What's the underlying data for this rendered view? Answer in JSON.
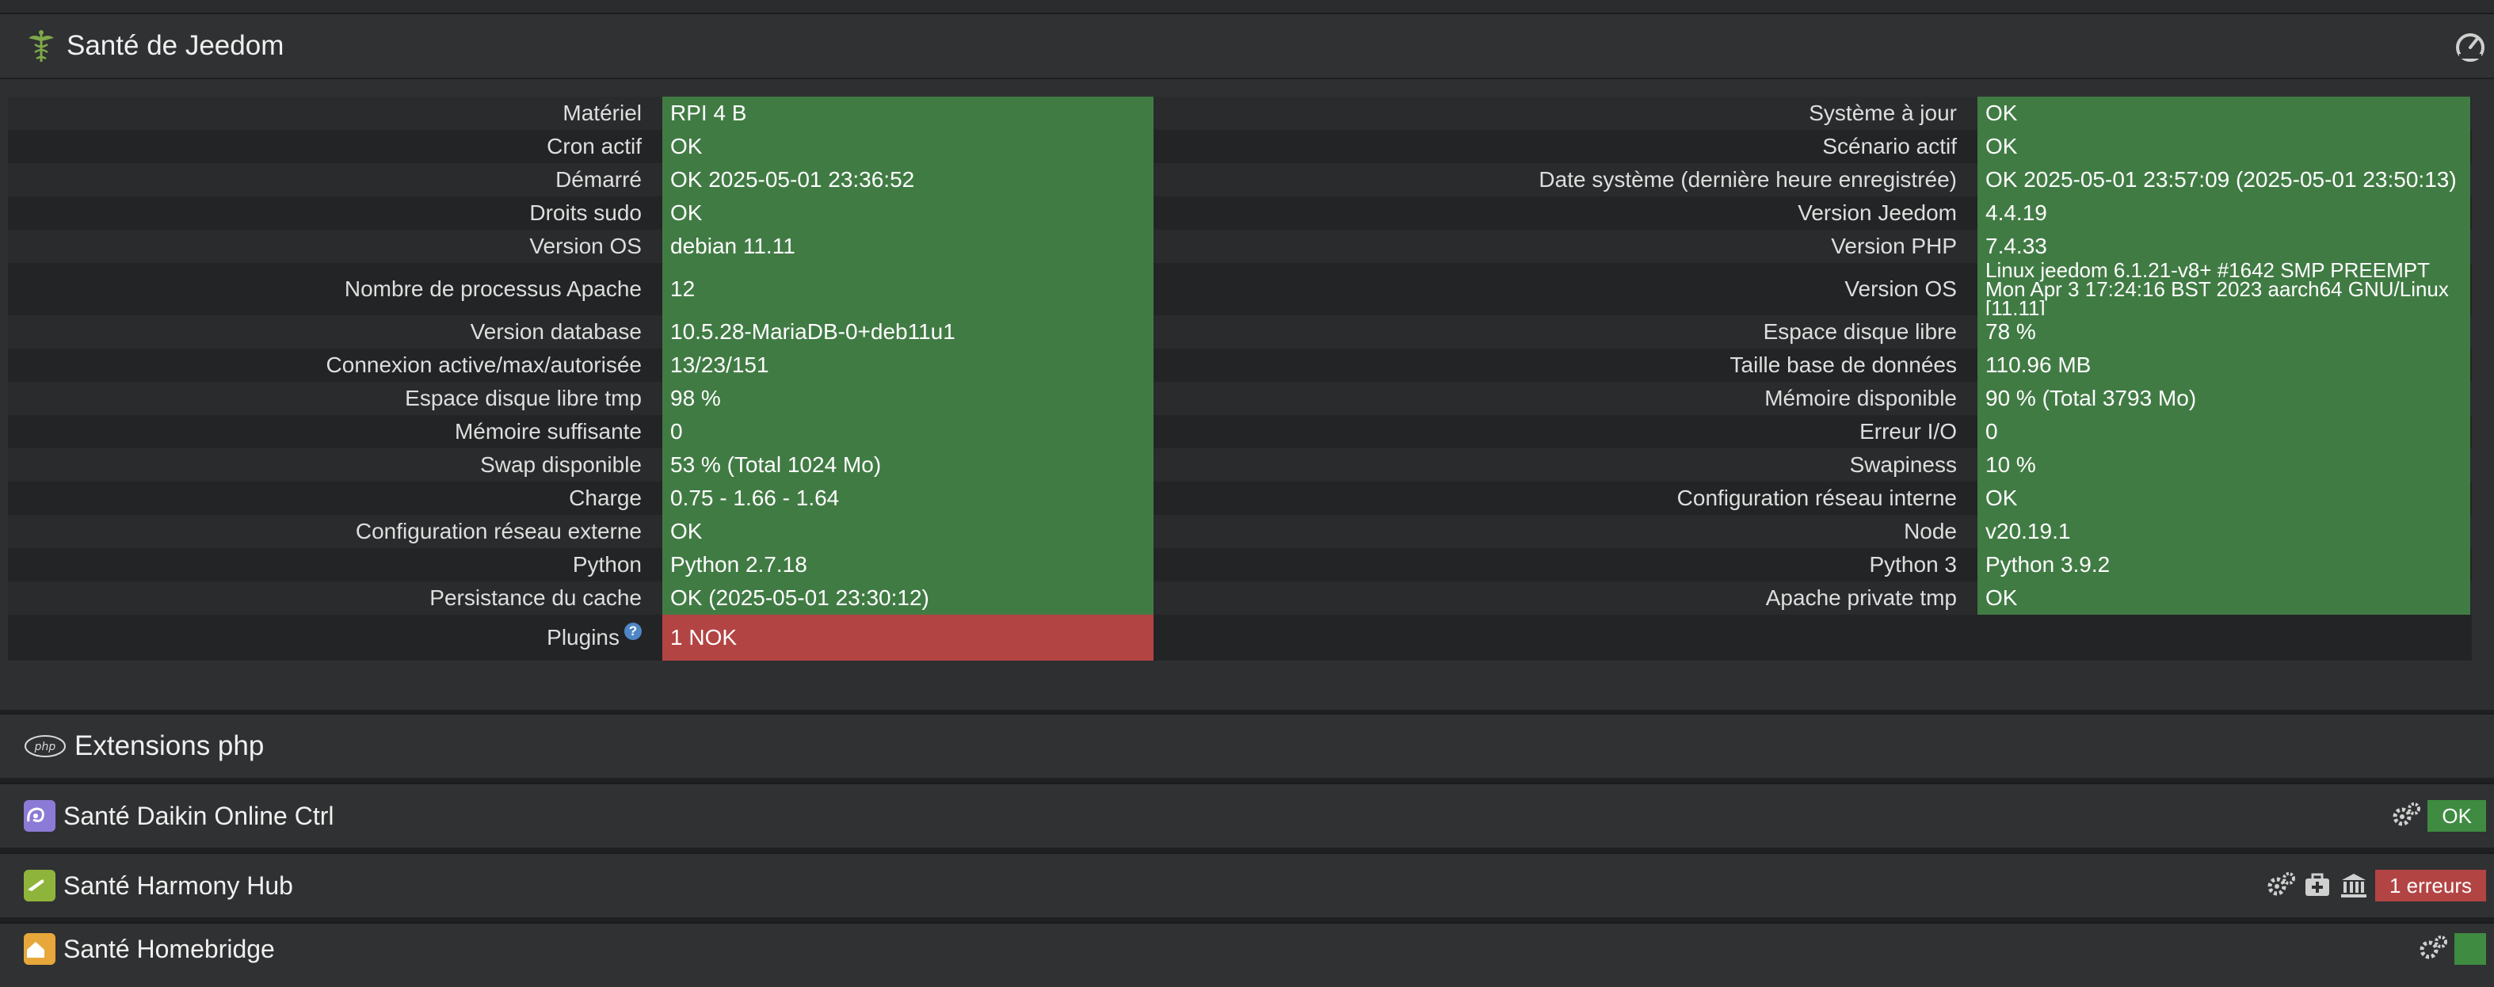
{
  "health": {
    "title": "Santé de Jeedom",
    "left_rows": [
      {
        "label": "Matériel",
        "value": "RPI 4 B"
      },
      {
        "label": "Cron actif",
        "value": "OK"
      },
      {
        "label": "Démarré",
        "value": "OK 2025-05-01 23:36:52"
      },
      {
        "label": "Droits sudo",
        "value": "OK"
      },
      {
        "label": "Version OS",
        "value": "debian 11.11"
      },
      {
        "label": "Nombre de processus Apache",
        "value": "12"
      },
      {
        "label": "Version database",
        "value": "10.5.28-MariaDB-0+deb11u1"
      },
      {
        "label": "Connexion active/max/autorisée",
        "value": "13/23/151"
      },
      {
        "label": "Espace disque libre tmp",
        "value": "98 %"
      },
      {
        "label": "Mémoire suffisante",
        "value": "0"
      },
      {
        "label": "Swap disponible",
        "value": "53 % (Total 1024 Mo)"
      },
      {
        "label": "Charge",
        "value": "0.75 - 1.66 - 1.64"
      },
      {
        "label": "Configuration réseau externe",
        "value": "OK"
      },
      {
        "label": "Python",
        "value": "Python 2.7.18"
      },
      {
        "label": "Persistance du cache",
        "value": "OK (2025-05-01 23:30:12)"
      },
      {
        "label": "Plugins",
        "value": "1 NOK",
        "status": "nok"
      }
    ],
    "right_rows": [
      {
        "label": "Système à jour",
        "value": "OK"
      },
      {
        "label": "Scénario actif",
        "value": "OK"
      },
      {
        "label": "Date système (dernière heure enregistrée)",
        "value": "OK 2025-05-01 23:57:09 (2025-05-01 23:50:13)"
      },
      {
        "label": "Version Jeedom",
        "value": "4.4.19"
      },
      {
        "label": "Version PHP",
        "value": "7.4.33"
      },
      {
        "label": "Version OS",
        "value": "Linux jeedom 6.1.21-v8+ #1642 SMP PREEMPT Mon Apr 3 17:24:16 BST 2023 aarch64 GNU/Linux [11.11]"
      },
      {
        "label": "Espace disque libre",
        "value": "78 %"
      },
      {
        "label": "Taille base de données",
        "value": "110.96 MB"
      },
      {
        "label": "Mémoire disponible",
        "value": "90 % (Total 3793 Mo)"
      },
      {
        "label": "Erreur I/O",
        "value": "0"
      },
      {
        "label": "Swapiness",
        "value": "10 %"
      },
      {
        "label": "Configuration réseau interne",
        "value": "OK"
      },
      {
        "label": "Node",
        "value": "v20.19.1"
      },
      {
        "label": "Python 3",
        "value": "Python 3.9.2"
      },
      {
        "label": "Apache private tmp",
        "value": "OK"
      }
    ]
  },
  "extensions": {
    "icon_text": "php",
    "title": "Extensions php"
  },
  "plugins": [
    {
      "title": "Santé Daikin Online Ctrl",
      "status": "OK",
      "status_type": "ok"
    },
    {
      "title": "Santé Harmony Hub",
      "status": "1 erreurs",
      "status_type": "err"
    },
    {
      "title": "Santé Homebridge",
      "status": "",
      "status_type": "ok"
    }
  ],
  "colors": {
    "ok": "#417b44",
    "nok": "#b34444",
    "background": "#1f2021",
    "panel": "#2e2f30"
  }
}
